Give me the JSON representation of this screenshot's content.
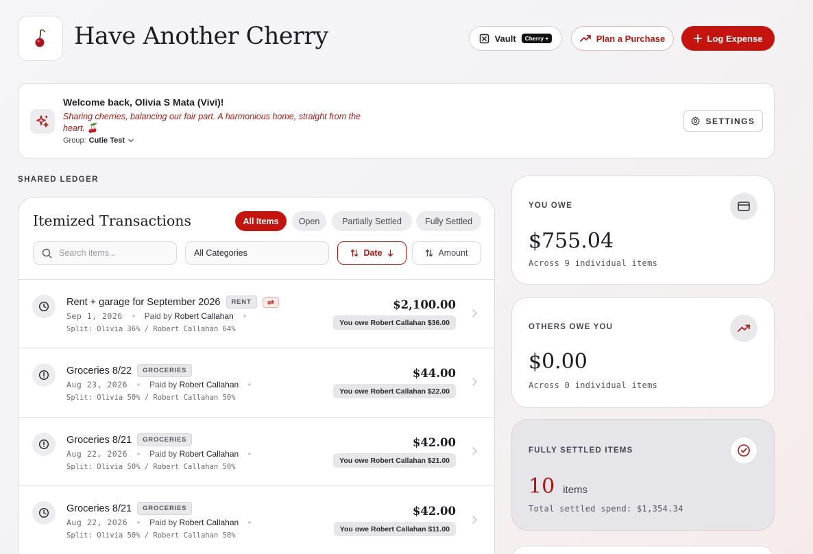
{
  "app": {
    "title": "Have Another Cherry",
    "logo_icon": "cherry-icon"
  },
  "header": {
    "vault_label": "Vault",
    "vault_badge": "Cherry +",
    "plan_label": "Plan a Purchase",
    "log_label": "Log Expense"
  },
  "welcome": {
    "title": "Welcome back, Olivia S Mata (Vivi)!",
    "tagline": "Sharing cherries, balancing our fair part. A harmonious home, straight from the heart. 🍒",
    "group_label": "Group:",
    "group_name": "Cutie Test",
    "settings_label": "SETTINGS"
  },
  "ledger": {
    "section_label": "SHARED LEDGER",
    "title": "Itemized Transactions",
    "filters": [
      "All Items",
      "Open",
      "Partially Settled",
      "Fully Settled"
    ],
    "active_filter": "All Items",
    "search_placeholder": "Search items...",
    "category_value": "All Categories",
    "sort_date_label": "Date",
    "sort_amount_label": "Amount",
    "transactions": [
      {
        "title": "Rent + garage for September 2026",
        "category": "RENT",
        "recurring": true,
        "status_icon": "clock-icon",
        "date": "Sep 1, 2026",
        "paid_by_label": "Paid by",
        "payer": "Robert Callahan",
        "split": "Split: Olivia 36% / Robert Callahan 64%",
        "amount": "$2,100.00",
        "owe_text": "You owe Robert Callahan $36.00"
      },
      {
        "title": "Groceries 8/22",
        "category": "GROCERIES",
        "recurring": false,
        "status_icon": "alert-circle-icon",
        "date": "Aug 23, 2026",
        "paid_by_label": "Paid by",
        "payer": "Robert Callahan",
        "split": "Split: Olivia 50% / Robert Callahan 50%",
        "amount": "$44.00",
        "owe_text": "You owe Robert Callahan $22.00"
      },
      {
        "title": "Groceries 8/21",
        "category": "GROCERIES",
        "recurring": false,
        "status_icon": "alert-circle-icon",
        "date": "Aug 22, 2026",
        "paid_by_label": "Paid by",
        "payer": "Robert Callahan",
        "split": "Split: Olivia 50% / Robert Callahan 50%",
        "amount": "$42.00",
        "owe_text": "You owe Robert Callahan $21.00"
      },
      {
        "title": "Groceries 8/21",
        "category": "GROCERIES",
        "recurring": false,
        "status_icon": "clock-icon",
        "date": "Aug 22, 2026",
        "paid_by_label": "Paid by",
        "payer": "Robert Callahan",
        "split": "Split: Olivia 50% / Robert Callahan 50%",
        "amount": "$42.00",
        "owe_text": "You owe Robert Callahan $11.00"
      }
    ]
  },
  "summary": {
    "you_owe": {
      "label": "YOU OWE",
      "value": "$755.04",
      "sub": "Across 9 individual items",
      "icon": "credit-card-icon"
    },
    "others_owe": {
      "label": "OTHERS OWE YOU",
      "value": "$0.00",
      "sub": "Across 0 individual items",
      "icon": "trending-up-icon"
    },
    "settled": {
      "label": "FULLY SETTLED ITEMS",
      "count": "10",
      "count_unit": "items",
      "sub": "Total settled spend: $1,354.34",
      "icon": "check-circle-icon"
    }
  },
  "colors": {
    "accent": "#c4140d",
    "accent_text": "#b3140e",
    "muted_bg": "#ececee",
    "settled_card_bg": "#e6e6ea"
  }
}
